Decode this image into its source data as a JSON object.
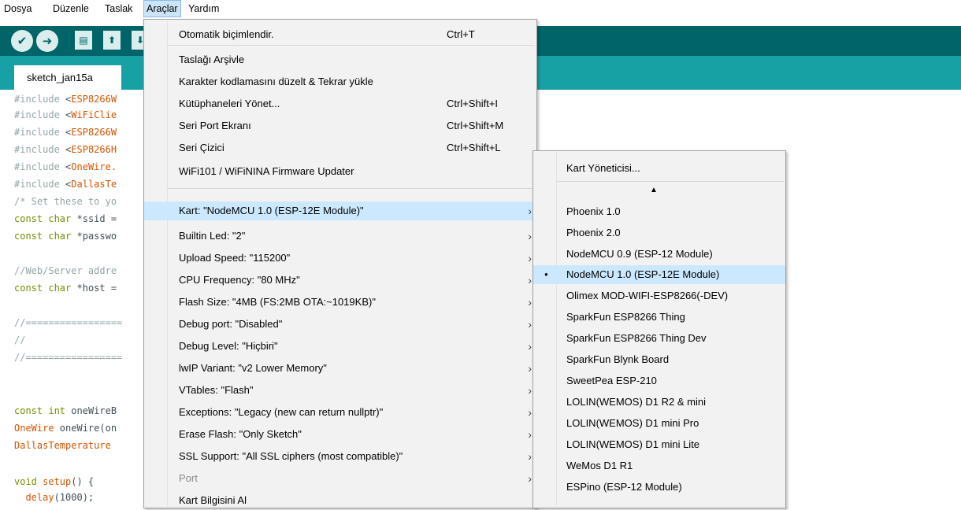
{
  "menubar": {
    "items": [
      "Dosya",
      "Düzenle",
      "Taslak",
      "Araçlar",
      "Yardım"
    ],
    "active": "Araçlar"
  },
  "toolbar": {
    "verify_icon": "check-icon",
    "upload_icon": "arrow-right-icon",
    "new_icon": "new-file-icon",
    "open_icon": "open-up-arrow-icon",
    "save_icon": "save-down-arrow-icon"
  },
  "tab": {
    "label": "sketch_jan15a"
  },
  "code": {
    "lines": [
      "#include <ESP8266W",
      "#include <WiFiClie",
      "#include <ESP8266W",
      "#include <ESP8266H",
      "#include <OneWire.",
      "#include <DallasTe",
      "/* Set these to yo",
      "const char *ssid =",
      "const char *passwo",
      "",
      "//Web/Server addre",
      "const char *host =",
      "",
      "//=================",
      "//",
      "//=================",
      "",
      "",
      "const int oneWireB",
      "OneWire oneWire(on",
      "DallasTemperature ",
      "",
      "void setup() {",
      "  delay(1000);"
    ]
  },
  "tools_menu": {
    "items": [
      {
        "label": "Otomatik biçimlendir.",
        "shortcut": "Ctrl+T"
      },
      {
        "label": "Taslağı Arşivle",
        "shortcut": ""
      },
      {
        "label": "Karakter kodlamasını düzelt & Tekrar yükle",
        "shortcut": ""
      },
      {
        "label": "Kütüphaneleri Yönet...",
        "shortcut": "Ctrl+Shift+I"
      },
      {
        "label": "Seri Port Ekranı",
        "shortcut": "Ctrl+Shift+M"
      },
      {
        "label": "Seri Çizici",
        "shortcut": "Ctrl+Shift+L"
      },
      {
        "label": "WiFi101 / WiFiNINA Firmware Updater",
        "shortcut": ""
      },
      {
        "label": "Kart: \"NodeMCU 1.0 (ESP-12E Module)\"",
        "shortcut": "",
        "submenu": true
      },
      {
        "label": "Builtin Led: \"2\"",
        "submenu": true
      },
      {
        "label": "Upload Speed: \"115200\"",
        "submenu": true
      },
      {
        "label": "CPU Frequency: \"80 MHz\"",
        "submenu": true
      },
      {
        "label": "Flash Size: \"4MB (FS:2MB OTA:~1019KB)\"",
        "submenu": true
      },
      {
        "label": "Debug port: \"Disabled\"",
        "submenu": true
      },
      {
        "label": "Debug Level: \"Hiçbiri\"",
        "submenu": true
      },
      {
        "label": "lwIP Variant: \"v2 Lower Memory\"",
        "submenu": true
      },
      {
        "label": "VTables: \"Flash\"",
        "submenu": true
      },
      {
        "label": "Exceptions: \"Legacy (new can return nullptr)\"",
        "submenu": true
      },
      {
        "label": "Erase Flash: \"Only Sketch\"",
        "submenu": true
      },
      {
        "label": "SSL Support: \"All SSL ciphers (most compatible)\"",
        "submenu": true
      },
      {
        "label": "Port",
        "submenu": true,
        "disabled": true
      },
      {
        "label": "Kart Bilgisini Al"
      }
    ]
  },
  "board_menu": {
    "manager": "Kart Yöneticisi...",
    "scroll_up": "▲",
    "items": [
      "Phoenix 1.0",
      "Phoenix 2.0",
      "NodeMCU 0.9 (ESP-12 Module)",
      "NodeMCU 1.0 (ESP-12E Module)",
      "Olimex MOD-WIFI-ESP8266(-DEV)",
      "SparkFun ESP8266 Thing",
      "SparkFun ESP8266 Thing Dev",
      "SparkFun Blynk Board",
      "SweetPea ESP-210",
      "LOLIN(WEMOS) D1 R2 & mini",
      "LOLIN(WEMOS) D1 mini Pro",
      "LOLIN(WEMOS) D1 mini Lite",
      "WeMos D1 R1",
      "ESPino (ESP-12 Module)"
    ],
    "selected": "NodeMCU 1.0 (ESP-12E Module)",
    "selected_marker": "●"
  }
}
